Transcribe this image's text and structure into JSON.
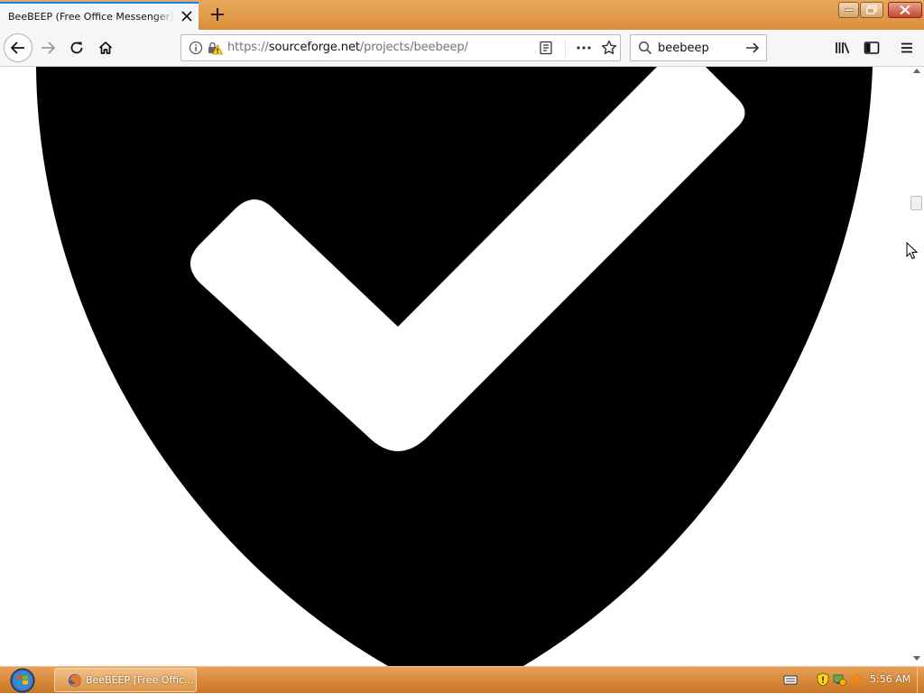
{
  "window": {
    "tab_title": "BeeBEEP (Free Office Messenger) download | SourceForge.net",
    "new_tab_label": "+"
  },
  "navbar": {
    "url_scheme": "https://",
    "url_host": "sourceforge.net",
    "url_path": "/projects/beebeep/",
    "search_value": "beebeep"
  },
  "content": {
    "image_description_icon": "shield-checkmark-icon",
    "scroll_position": 0.22
  },
  "taskbar": {
    "task_label": "BeeBEEP [Free Offic...",
    "clock": "5:56 AM"
  },
  "colors": {
    "tab_accent": "#0a84ff",
    "chrome_orange": "#e29b48",
    "shield": "#000000"
  }
}
